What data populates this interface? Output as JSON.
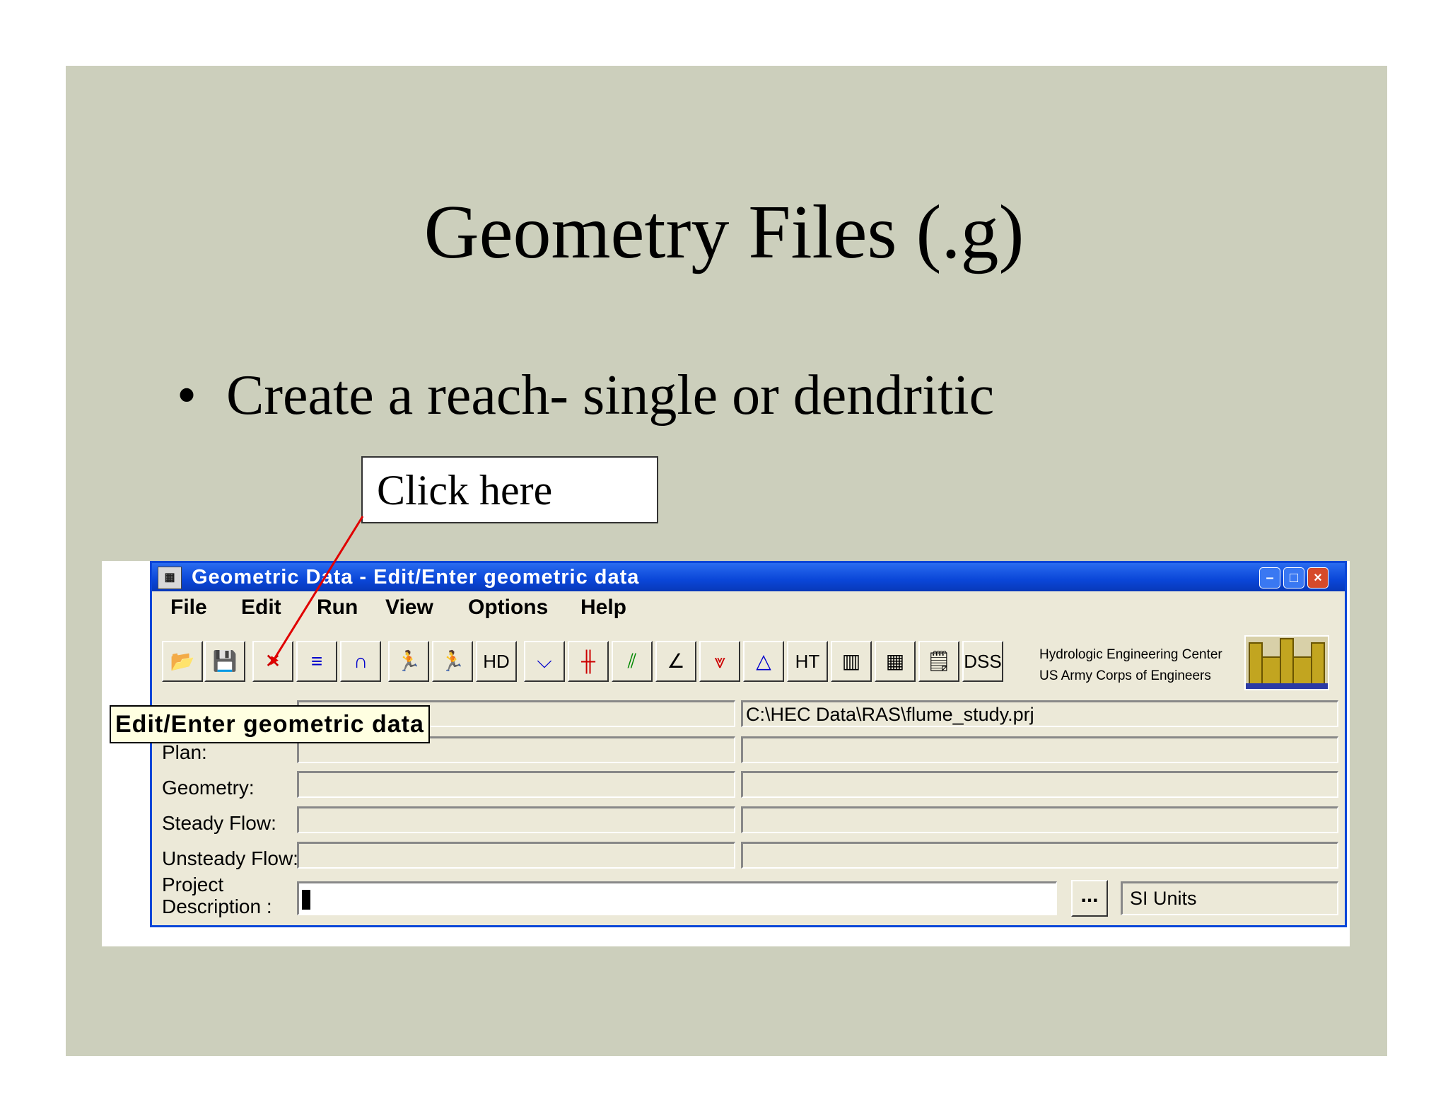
{
  "slide": {
    "title": "Geometry Files (.g)",
    "bullet_marker": "•",
    "bullet": "Create a reach- single or dendritic",
    "callout": "Click here"
  },
  "window": {
    "title": "Geometric Data - Edit/Enter geometric data",
    "controls": {
      "minimize": "–",
      "maximize": "□",
      "close": "×"
    },
    "menu": [
      "File",
      "Edit",
      "Run",
      "View",
      "Options",
      "Help"
    ],
    "toolbar_text_buttons": {
      "hd": "HD",
      "ht": "HT",
      "dss": "DSS"
    },
    "hec_line1": "Hydrologic Engineering Center",
    "hec_line2": "US Army Corps of Engineers",
    "tooltip": "Edit/Enter geometric data",
    "rows": {
      "project_path": "C:\\HEC Data\\RAS\\flume_study.prj",
      "plan_label": "Plan:",
      "geometry_label": "Geometry:",
      "steady_label": "Steady Flow:",
      "unsteady_label": "Unsteady Flow:",
      "desc_label_1": "Project",
      "desc_label_2": "Description :",
      "browse_button": "...",
      "units": "SI Units"
    }
  },
  "colors": {
    "slide_bg": "#cccfbc",
    "titlebar": "#0a46d8",
    "arrow": "#e00000",
    "tooltip_bg": "#ffffe1"
  }
}
